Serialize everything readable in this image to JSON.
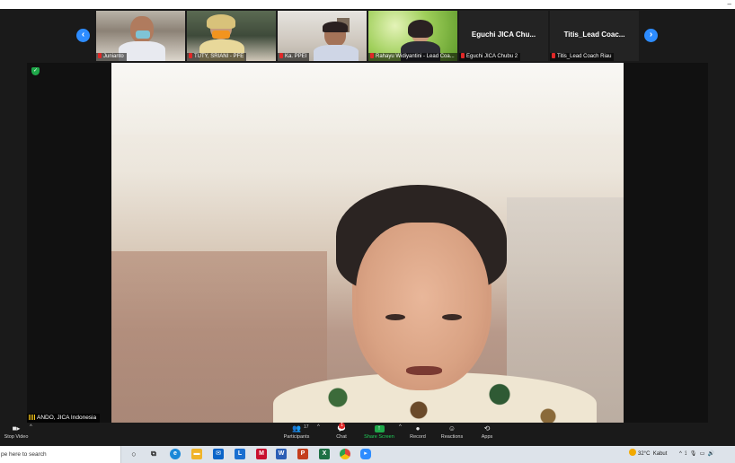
{
  "thumbnails": [
    {
      "label": "Junianto",
      "muted": true
    },
    {
      "label": "TUTY, SRIANI - PFE",
      "muted": true
    },
    {
      "label": "Ka. PPEI",
      "muted": true
    },
    {
      "label": "Rahayu Widiyantini - Lead Coa...",
      "muted": true
    },
    {
      "label": "Eguchi JICA Chubu 2",
      "big_name": "Eguchi JICA Chu...",
      "muted": true
    },
    {
      "label": "Titis_Lead Coach Riau",
      "big_name": "Titis_Lead  Coac...",
      "muted": true
    }
  ],
  "main_speaker": {
    "label": "ANDO, JICA Indonesia"
  },
  "controls": {
    "stop_video": "Stop Video",
    "participants": "Participants",
    "participants_count": "17",
    "chat": "Chat",
    "chat_badge": "1",
    "share_screen": "Share Screen",
    "record": "Record",
    "reactions": "Reactions",
    "apps": "Apps"
  },
  "taskbar": {
    "search_placeholder": "pe here to search",
    "weather_temp": "32°C",
    "weather_text": "Kabut"
  },
  "colors": {
    "accent": "#2d8cff",
    "share_green": "#1fa84a",
    "muted_red": "#e02828",
    "background": "#1a1a1a"
  }
}
